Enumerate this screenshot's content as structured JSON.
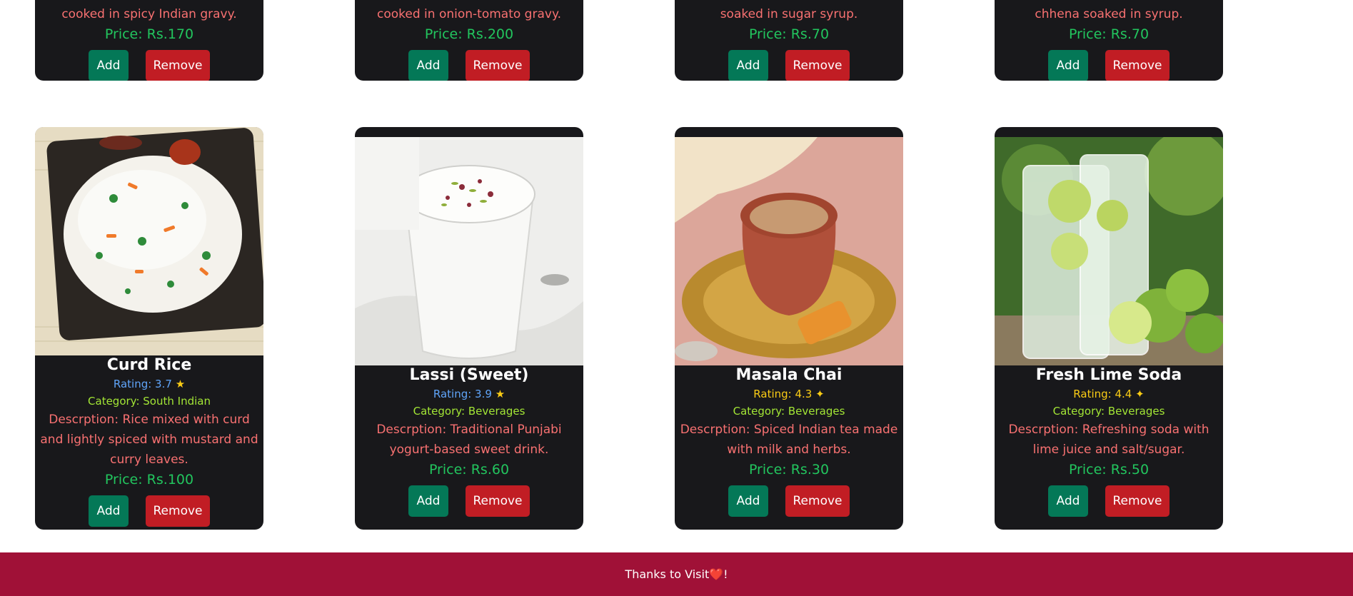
{
  "top_cards": [
    {
      "desc": "cooked in spicy Indian gravy.",
      "price": "Price: Rs.170",
      "add": "Add",
      "remove": "Remove"
    },
    {
      "desc": "cooked in onion-tomato gravy.",
      "price": "Price: Rs.200",
      "add": "Add",
      "remove": "Remove"
    },
    {
      "desc": "soaked in sugar syrup.",
      "price": "Price: Rs.70",
      "add": "Add",
      "remove": "Remove"
    },
    {
      "desc": "chhena soaked in syrup.",
      "price": "Price: Rs.70",
      "add": "Add",
      "remove": "Remove"
    }
  ],
  "cards": [
    {
      "title": "Curd Rice",
      "rating": "Rating: 3.7",
      "rating_icon": "star-icon",
      "category": "Category: South Indian",
      "desc": "Descrption: Rice mixed with curd and lightly spiced with mustard and curry leaves.",
      "price": "Price: Rs.100",
      "add": "Add",
      "remove": "Remove",
      "rating_color": "#60a5fa"
    },
    {
      "title": "Lassi (Sweet)",
      "rating": "Rating: 3.9",
      "rating_icon": "star-icon",
      "category": "Category: Beverages",
      "desc": "Descrption: Traditional Punjabi yogurt-based sweet drink.",
      "price": "Price: Rs.60",
      "add": "Add",
      "remove": "Remove",
      "rating_color": "#60a5fa"
    },
    {
      "title": "Masala Chai",
      "rating": "Rating: 4.3",
      "rating_icon": "glowing-star-icon",
      "category": "Category: Beverages",
      "desc": "Descrption: Spiced Indian tea made with milk and herbs.",
      "price": "Price: Rs.30",
      "add": "Add",
      "remove": "Remove",
      "rating_color": "#facc15"
    },
    {
      "title": "Fresh Lime Soda",
      "rating": "Rating: 4.4",
      "rating_icon": "glowing-star-icon",
      "category": "Category: Beverages",
      "desc": "Descrption: Refreshing soda with lime juice and salt/sugar.",
      "price": "Price: Rs.50",
      "add": "Add",
      "remove": "Remove",
      "rating_color": "#facc15"
    }
  ],
  "footer": {
    "text": "Thanks to Visit",
    "heart": "❤️",
    "suffix": "!"
  }
}
